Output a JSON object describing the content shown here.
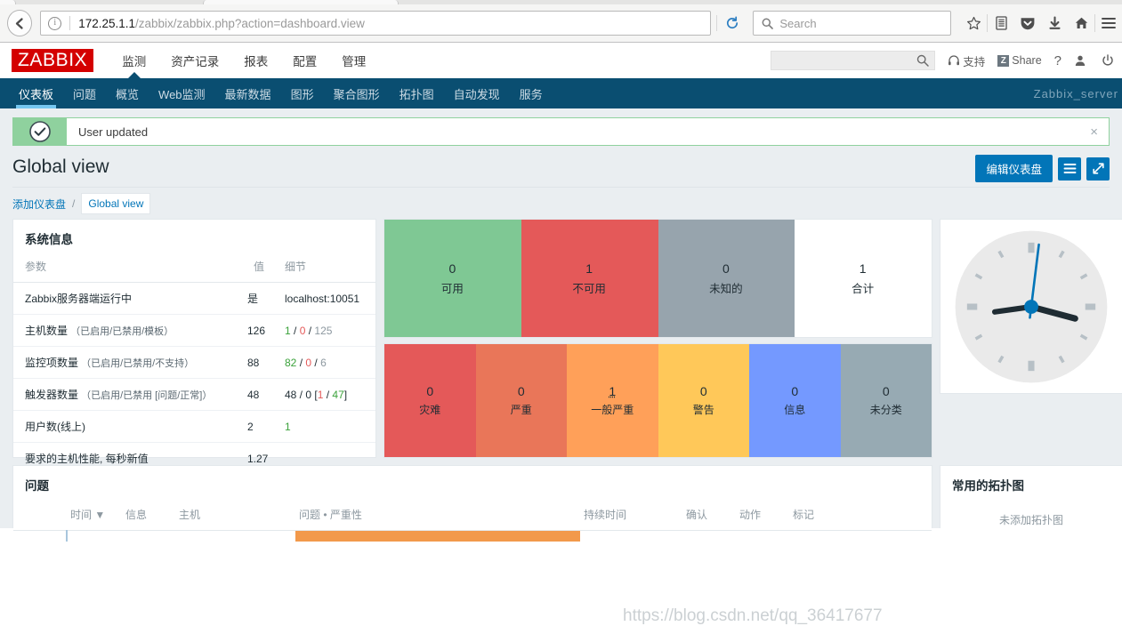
{
  "browser": {
    "url_host": "172.25.1.1",
    "url_path": "/zabbix/zabbix.php?action=dashboard.view",
    "search_placeholder": "Search",
    "icons": {
      "back": "back-arrow-icon",
      "info": "page-info-icon",
      "reload": "reload-icon",
      "search": "search-icon",
      "bookmark": "star-icon",
      "library": "library-icon",
      "pocket": "pocket-icon",
      "downloads": "download-icon",
      "home": "home-icon",
      "menu": "hamburger-menu-icon"
    }
  },
  "zabbix": {
    "logo": "ZABBIX",
    "main_menu": [
      {
        "label": "监测",
        "selected": true
      },
      {
        "label": "资产记录",
        "selected": false
      },
      {
        "label": "报表",
        "selected": false
      },
      {
        "label": "配置",
        "selected": false
      },
      {
        "label": "管理",
        "selected": false
      }
    ],
    "header_right": {
      "search_value": "",
      "support": "支持",
      "share": "Share",
      "share_badge": "Z",
      "help": "?",
      "user_icon": "user-icon",
      "signout_icon": "power-icon"
    },
    "subnav": [
      {
        "label": "仪表板",
        "selected": true
      },
      {
        "label": "问题",
        "selected": false
      },
      {
        "label": "概览",
        "selected": false
      },
      {
        "label": "Web监测",
        "selected": false
      },
      {
        "label": "最新数据",
        "selected": false
      },
      {
        "label": "图形",
        "selected": false
      },
      {
        "label": "聚合图形",
        "selected": false
      },
      {
        "label": "拓扑图",
        "selected": false
      },
      {
        "label": "自动发现",
        "selected": false
      },
      {
        "label": "服务",
        "selected": false
      }
    ],
    "server_name": "Zabbix_server"
  },
  "message": {
    "text": "User updated",
    "close": "×",
    "icon": "check-circle-icon",
    "color": "#8fd19e"
  },
  "page": {
    "title": "Global view",
    "edit_button": "编辑仪表盘",
    "menu_icon": "kebab-list-icon",
    "fullscreen_icon": "expand-icon",
    "accent": "#0275b8"
  },
  "breadcrumb": {
    "add_dashboard": "添加仪表盘",
    "separator": "/",
    "current": "Global view"
  },
  "sysinfo": {
    "title": "系统信息",
    "columns": [
      "参数",
      "值",
      "细节"
    ],
    "rows": [
      {
        "param": "Zabbix服务器端运行中",
        "param_sub": "",
        "value": "是",
        "value_class": "g",
        "detail_parts": [
          {
            "t": "localhost:10051",
            "c": ""
          }
        ]
      },
      {
        "param": "主机数量",
        "param_sub": "（已启用/已禁用/模板）",
        "value": "126",
        "value_class": "",
        "detail_parts": [
          {
            "t": "1",
            "c": "g"
          },
          {
            "t": " / ",
            "c": ""
          },
          {
            "t": "0",
            "c": "r"
          },
          {
            "t": " / ",
            "c": ""
          },
          {
            "t": "125",
            "c": "gry"
          }
        ]
      },
      {
        "param": "监控项数量",
        "param_sub": "（已启用/已禁用/不支持）",
        "value": "88",
        "value_class": "",
        "detail_parts": [
          {
            "t": "82",
            "c": "g"
          },
          {
            "t": " / ",
            "c": ""
          },
          {
            "t": "0",
            "c": "r"
          },
          {
            "t": " / ",
            "c": ""
          },
          {
            "t": "6",
            "c": "gry"
          }
        ]
      },
      {
        "param": "触发器数量",
        "param_sub": "（已启用/已禁用 [问题/正常]）",
        "value": "48",
        "value_class": "",
        "detail_parts": [
          {
            "t": "48 / 0 [",
            "c": ""
          },
          {
            "t": "1",
            "c": "r"
          },
          {
            "t": " / ",
            "c": ""
          },
          {
            "t": "47",
            "c": "g"
          },
          {
            "t": "]",
            "c": ""
          }
        ]
      },
      {
        "param": "用户数(线上)",
        "param_sub": "",
        "value": "2",
        "value_class": "",
        "detail_parts": [
          {
            "t": "1",
            "c": "g"
          }
        ]
      },
      {
        "param": "要求的主机性能, 每秒新值",
        "param_sub": "",
        "value": "1.27",
        "value_class": "",
        "detail_parts": []
      }
    ]
  },
  "host_availability": {
    "cells": [
      {
        "value": "0",
        "label": "可用",
        "bg": "#7fc894",
        "fg": "#1f2c33"
      },
      {
        "value": "1",
        "label": "不可用",
        "bg": "#e45959",
        "fg": "#1f2c33"
      },
      {
        "value": "0",
        "label": "未知的",
        "bg": "#97a4ad",
        "fg": "#1f2c33"
      },
      {
        "value": "1",
        "label": "合计",
        "bg": "#ffffff",
        "fg": "#1f2c33"
      }
    ]
  },
  "problem_severity": {
    "cells": [
      {
        "value": "0",
        "label": "灾难",
        "bg": "#e45959",
        "fg": "#1f2c33",
        "link": false
      },
      {
        "value": "0",
        "label": "严重",
        "bg": "#e97659",
        "fg": "#1f2c33",
        "link": false
      },
      {
        "value": "1",
        "label": "一般严重",
        "bg": "#ffa059",
        "fg": "#1f2c33",
        "link": true
      },
      {
        "value": "0",
        "label": "警告",
        "bg": "#ffc859",
        "fg": "#1f2c33",
        "link": false
      },
      {
        "value": "0",
        "label": "信息",
        "bg": "#7499ff",
        "fg": "#1f2c33",
        "link": false
      },
      {
        "value": "0",
        "label": "未分类",
        "bg": "#97aab3",
        "fg": "#1f2c33",
        "link": false
      }
    ]
  },
  "clock": {
    "hour_angle": 105,
    "minute_angle": 262,
    "second_angle": 7,
    "hand_color": "#1f2c33",
    "second_color": "#0275b8"
  },
  "problems": {
    "title": "问题",
    "columns": [
      "时间",
      "信息",
      "主机",
      "问题 • 严重性",
      "持续时间",
      "确认",
      "动作",
      "标记"
    ],
    "sort_indicator": "▼"
  },
  "maps": {
    "title": "常用的拓扑图",
    "empty_text": "未添加拓扑图"
  },
  "watermark": "https://blog.csdn.net/qq_36417677"
}
